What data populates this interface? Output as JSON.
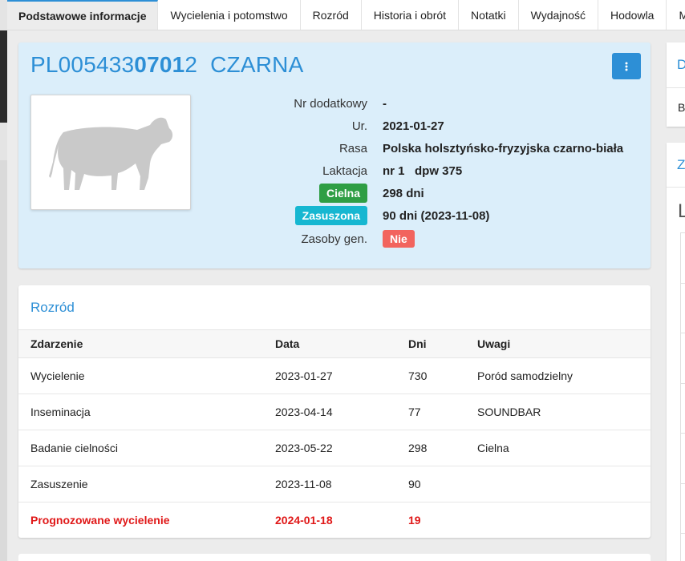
{
  "tabs": [
    {
      "label": "Podstawowe informacje",
      "active": true
    },
    {
      "label": "Wycielenia i potomstwo"
    },
    {
      "label": "Rozród"
    },
    {
      "label": "Historia i obrót"
    },
    {
      "label": "Notatki"
    },
    {
      "label": "Wydajność"
    },
    {
      "label": "Hodowla"
    },
    {
      "label": "M"
    }
  ],
  "cow": {
    "id_prefix": "PL005433",
    "id_bold": "0701",
    "id_suffix": "2",
    "name": "CZARNA",
    "menu_icon": "vertical-dots-icon",
    "photo_icon": "cow-silhouette-icon"
  },
  "info": {
    "extra_label": "Nr dodatkowy",
    "extra_value": "-",
    "born_label": "Ur.",
    "born_value": "2021-01-27",
    "breed_label": "Rasa",
    "breed_value": "Polska holsztyńsko-fryzyjska czarno-biała",
    "lactation_label": "Laktacja",
    "lactation_value": "nr 1   dpw 375",
    "pregnant_badge": "Cielna",
    "pregnant_value": "298 dni",
    "dry_badge": "Zasuszona",
    "dry_value": "90 dni (2023-11-08)",
    "genres_label": "Zasoby gen.",
    "genres_badge": "Nie"
  },
  "colors": {
    "accent": "#2d8fd6",
    "green": "#2f9e44",
    "cyan": "#16b7d1",
    "red": "#f2645e",
    "predicted": "#e01818"
  },
  "rozrod": {
    "title": "Rozród",
    "headers": [
      "Zdarzenie",
      "Data",
      "Dni",
      "Uwagi"
    ],
    "rows": [
      [
        "Wycielenie",
        "2023-01-27",
        "730",
        "Poród samodzielny"
      ],
      [
        "Inseminacja",
        "2023-04-14",
        "77",
        "SOUNDBAR"
      ],
      [
        "Badanie cielności",
        "2023-05-22",
        "298",
        "Cielna"
      ],
      [
        "Zasuszenie",
        "2023-11-08",
        "90",
        ""
      ],
      [
        "Prognozowane wycielenie",
        "2024-01-18",
        "19",
        ""
      ]
    ]
  },
  "right_panels": {
    "p1_title": "D",
    "p1_text": "B",
    "p2_title": "Z",
    "p2_big": "L"
  }
}
